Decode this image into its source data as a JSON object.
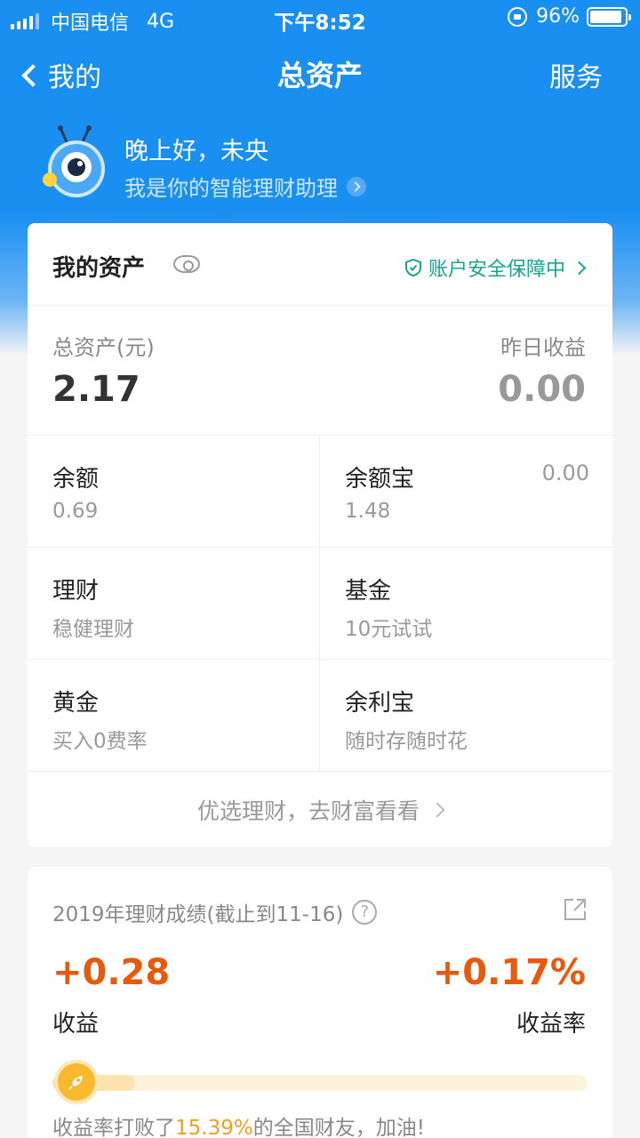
{
  "status_bar": {
    "carrier": "中国电信",
    "network": "4G",
    "time": "下午8:52",
    "battery": "96%"
  },
  "nav": {
    "back_label": "我的",
    "title": "总资产",
    "service_label": "服务"
  },
  "assistant": {
    "greeting": "晚上好，未央",
    "subtitle": "我是你的智能理财助理"
  },
  "assets": {
    "title": "我的资产",
    "security_label": "账户安全保障中",
    "total_label": "总资产(元)",
    "total_value": "2.17",
    "yesterday_label": "昨日收益",
    "yesterday_value": "0.00",
    "items": [
      {
        "name": "余额",
        "desc": "0.69",
        "aside": ""
      },
      {
        "name": "余额宝",
        "desc": "1.48",
        "aside": "0.00"
      },
      {
        "name": "理财",
        "desc": "稳健理财",
        "aside": ""
      },
      {
        "name": "基金",
        "desc": "10元试试",
        "aside": ""
      },
      {
        "name": "黄金",
        "desc": "买入0费率",
        "aside": ""
      },
      {
        "name": "余利宝",
        "desc": "随时存随时花",
        "aside": ""
      }
    ],
    "more_label": "优选理财，去财富看看"
  },
  "performance": {
    "title": "2019年理财成绩(截止到11-16)",
    "help": "?",
    "gain_value": "+0.28",
    "gain_label": "收益",
    "rate_value": "+0.17%",
    "rate_label": "收益率",
    "beat_prefix": "收益率打败了",
    "beat_percent": "15.39%",
    "beat_suffix": "的全国财友，加油!",
    "beat_fraction": 0.1539
  },
  "colors": {
    "primary": "#1a8ff2",
    "accent_orange": "#e8590c",
    "secure_green": "#17a58d",
    "highlight_yellow": "#f0a020"
  }
}
